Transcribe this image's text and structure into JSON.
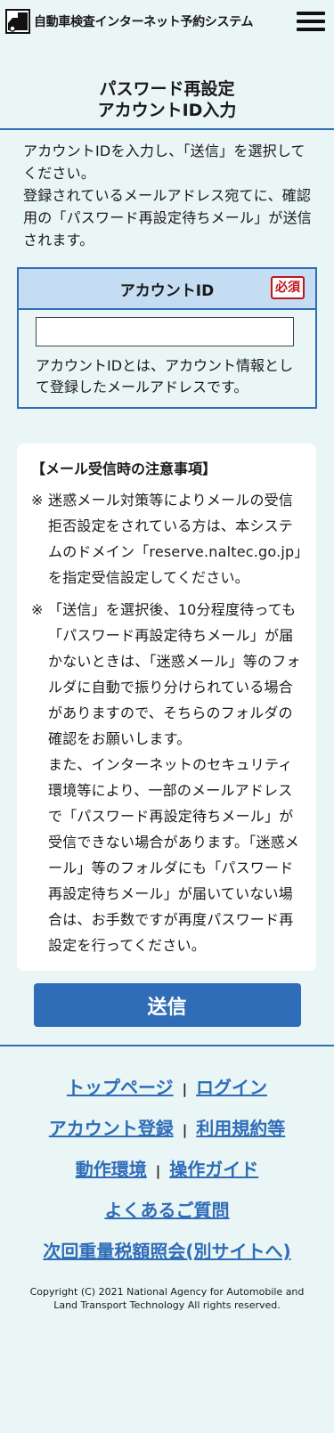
{
  "header": {
    "site_title": "自動車検査インターネット予約システム",
    "logo_icon": "car-inspection-logo-icon",
    "menu_icon": "hamburger-menu-icon"
  },
  "page": {
    "title_line1": "パスワード再設定",
    "title_line2": "アカウントID入力"
  },
  "intro": {
    "line1": "アカウントIDを入力し、「送信」を選択してください。",
    "line2": "登録されているメールアドレス宛てに、確認用の「パスワード再設定待ちメール」が送信されます。"
  },
  "account_field": {
    "label": "アカウントID",
    "required_badge": "必須",
    "value": "",
    "placeholder": "",
    "note": "アカウントIDとは、アカウント情報として登録したメールアドレスです。"
  },
  "notice": {
    "title": "【メール受信時の注意事項】",
    "mark": "※",
    "item1": "迷惑メール対策等によりメールの受信拒否設定をされている方は、本システムのドメイン「reserve.naltec.go.jp」を指定受信設定してください。",
    "item2_p1": "「送信」を選択後、10分程度待っても「パスワード再設定待ちメール」が届かないときは、「迷惑メール」等のフォルダに自動で振り分けられている場合がありますので、そちらのフォルダの確認をお願いします。",
    "item2_p2": "また、インターネットのセキュリティ環境等により、一部のメールアドレスで「パスワード再設定待ちメール」が受信できない場合があります。「迷惑メール」等のフォルダにも「パスワード再設定待ちメール」が届いていない場合は、お手数ですが再度パスワード再設定を行ってください。"
  },
  "submit_label": "送信",
  "footer": {
    "separator": "|",
    "top_page": "トップページ",
    "login": "ログイン",
    "account_register": "アカウント登録",
    "terms": "利用規約等",
    "environment": "動作環境",
    "guide": "操作ガイド",
    "faq": "よくあるご質問",
    "tax_lookup": "次回重量税額照会(別サイトへ)",
    "copyright": "Copyright (C) 2021 National Agency for Automobile and Land Transport Technology All rights reserved."
  },
  "colors": {
    "background": "#eaf5f5",
    "accent": "#2f6db8",
    "header_fill": "#c5ddf2",
    "required": "#c0141a"
  }
}
